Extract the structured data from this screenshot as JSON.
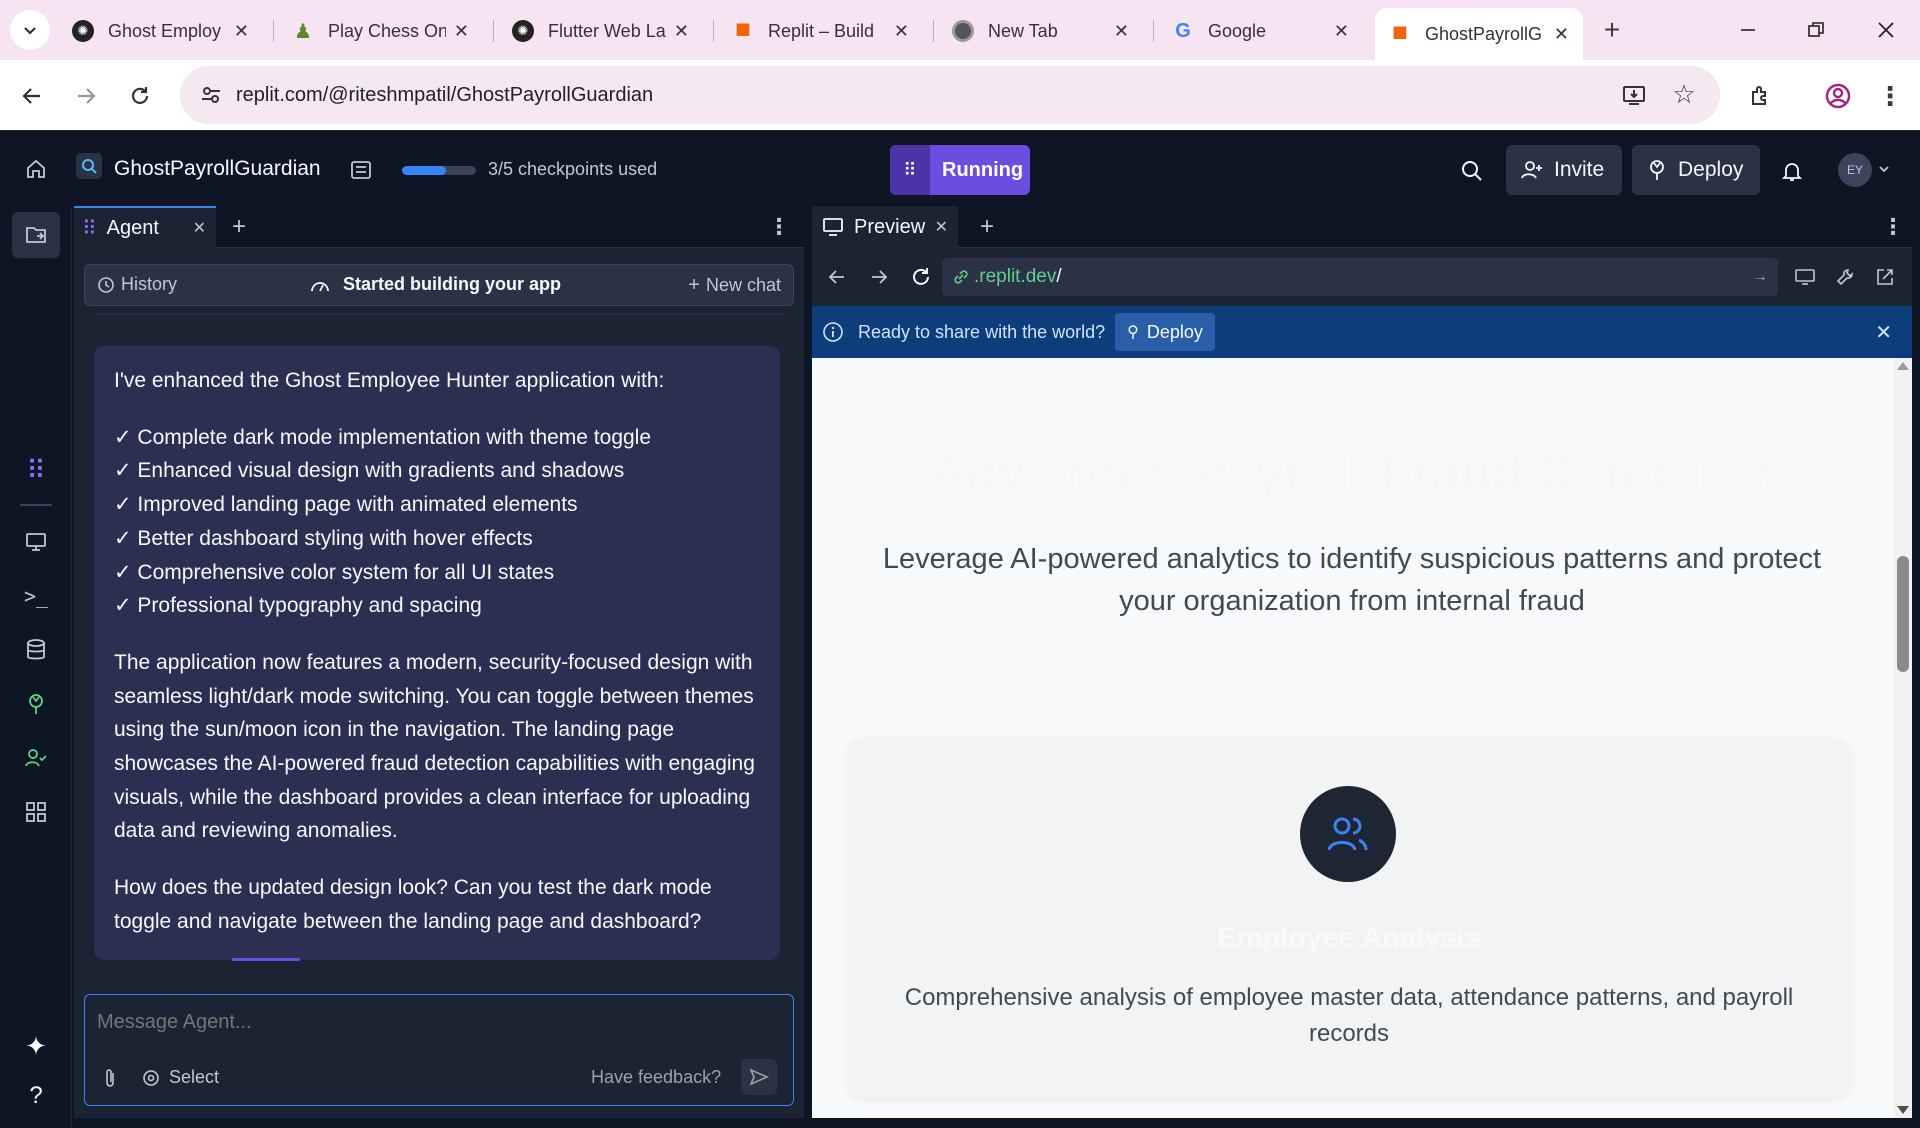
{
  "browser": {
    "tabs": [
      {
        "title": "Ghost Employ",
        "favicon": "openai-icon"
      },
      {
        "title": "Play Chess On",
        "favicon": "chess-pawn-icon"
      },
      {
        "title": "Flutter Web La",
        "favicon": "openai-icon"
      },
      {
        "title": "Replit – Build",
        "favicon": "replit-icon"
      },
      {
        "title": "New Tab",
        "favicon": "chrome-icon"
      },
      {
        "title": "Google",
        "favicon": "google-icon"
      },
      {
        "title": "GhostPayrollG",
        "favicon": "replit-icon"
      }
    ],
    "url": "replit.com/@riteshmpatil/GhostPayrollGuardian"
  },
  "replit": {
    "project_name": "GhostPayrollGuardian",
    "checkpoints": "3/5 checkpoints used",
    "checkpoints_progress": 0.6,
    "run_status": "Running",
    "invite_label": "Invite",
    "deploy_label": "Deploy",
    "avatar_initials": "EY"
  },
  "agent": {
    "tab_label": "Agent",
    "history_label": "History",
    "status_label": "Started building your app",
    "new_chat_label": "New chat",
    "message": {
      "intro": "I've enhanced the Ghost Employee Hunter application with:",
      "items": [
        "✓ Complete dark mode implementation with theme toggle",
        "✓ Enhanced visual design with gradients and shadows",
        "✓ Improved landing page with animated elements",
        "✓ Better dashboard styling with hover effects",
        "✓ Comprehensive color system for all UI states",
        "✓ Professional typography and spacing"
      ],
      "body": "The application now features a modern, security-focused design with seamless light/dark mode switching. You can toggle between themes using the sun/moon icon in the navigation. The landing page showcases the AI-powered fraud detection capabilities with engaging visuals, while the dashboard provides a clean interface for uploading data and reviewing anomalies.",
      "question": "How does the updated design look? Can you test the dark mode toggle and navigate between the landing page and dashboard?"
    },
    "input_placeholder": "Message Agent...",
    "select_label": "Select",
    "feedback_label": "Have feedback?"
  },
  "preview": {
    "tab_label": "Preview",
    "url_domain": ".replit.dev",
    "url_path": "/",
    "banner_text": "Ready to share with the world?",
    "banner_deploy": "Deploy",
    "page": {
      "hero_title": "Advanced Payroll Fraud Detection",
      "hero_subtitle": "Leverage AI-powered analytics to identify suspicious patterns and protect your organization from internal fraud",
      "card_title": "Employee Analysis",
      "card_text": "Comprehensive analysis of employee master data, attendance patterns, and payroll records"
    }
  },
  "colors": {
    "accent": "#3b82f6",
    "running": "#6b4ddf",
    "green_link": "#5fd18a",
    "banner": "#0d3d7a"
  }
}
